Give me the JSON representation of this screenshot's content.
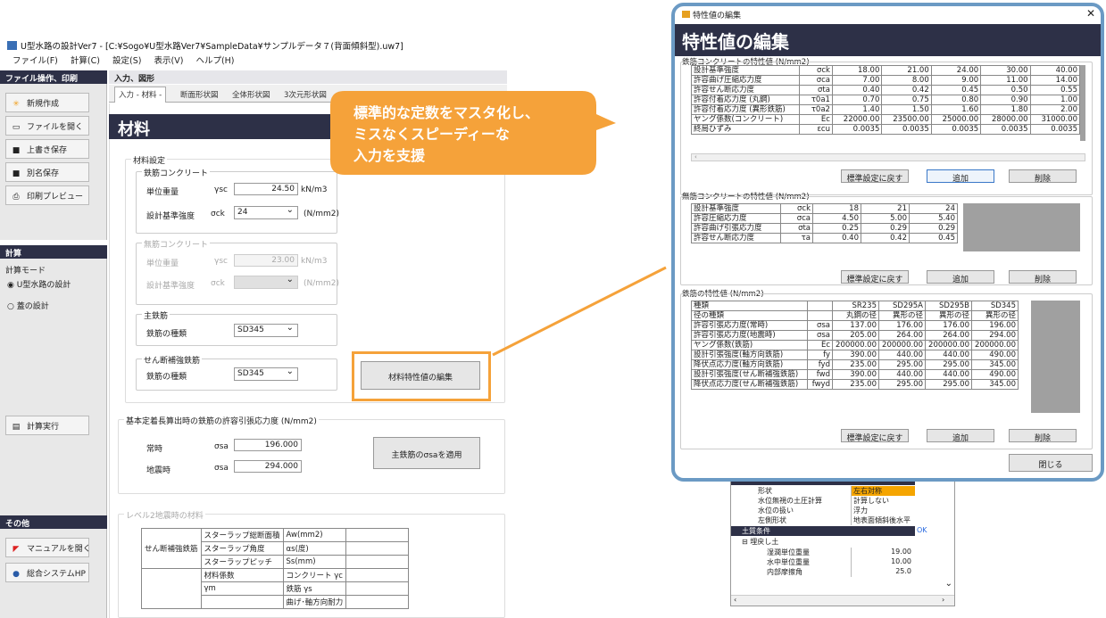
{
  "window": {
    "title": "U型水路の設計Ver7 - [C:¥Sogo¥U型水路Ver7¥SampleData¥サンプルデータ７(背面傾斜型).uw7]"
  },
  "menu": [
    "ファイル(F)",
    "計算(C)",
    "設定(S)",
    "表示(V)",
    "ヘルプ(H)"
  ],
  "left_panel": {
    "file_header": "ファイル操作、印刷",
    "buttons": [
      "新規作成",
      "ファイルを開く",
      "上書き保存",
      "別名保存",
      "印刷プレビュー"
    ],
    "calc_header": "計算",
    "calc_mode_label": "計算モード",
    "modes": [
      "U型水路の設計",
      "蓋の設計"
    ],
    "run_button": "計算実行",
    "other_header": "その他",
    "other_buttons": [
      "マニュアルを開く",
      "総合システムHP"
    ]
  },
  "main": {
    "header": "入力、図形",
    "tabs": [
      "入力 - 材料 -",
      "断面形状図",
      "全体形状図",
      "3次元形状図"
    ],
    "section_title": "材料",
    "material_settings": "材料設定",
    "rc": {
      "title": "鉄筋コンクリート",
      "unit_weight_label": "単位重量",
      "unit_weight_sym": "γsc",
      "unit_weight": "24.50",
      "unit_weight_unit": "kN/m3",
      "strength_label": "設計基準強度",
      "strength_sym": "σck",
      "strength": "24",
      "strength_unit": "(N/mm2)"
    },
    "plain": {
      "title": "無筋コンクリート",
      "unit_weight_label": "単位重量",
      "unit_weight_sym": "γsc",
      "unit_weight": "23.00",
      "unit_weight_unit": "kN/m3",
      "strength_label": "設計基準強度",
      "strength_sym": "σck",
      "strength_unit": "(N/mm2)"
    },
    "main_rebar": {
      "title": "主鉄筋",
      "label": "鉄筋の種類",
      "value": "SD345"
    },
    "shear_rebar": {
      "title": "せん断補強鉄筋",
      "label": "鉄筋の種類",
      "value": "SD345"
    },
    "edit_button": "材料特性値の編集",
    "anchor": {
      "title": "基本定着長算出時の鉄筋の許容引張応力度 (N/mm2)",
      "normal_label": "常時",
      "quake_label": "地震時",
      "sym": "σsa",
      "normal": "196.000",
      "quake": "294.000",
      "apply_button": "主鉄筋のσsaを適用"
    },
    "level2": {
      "title": "レベル2地震時の材料",
      "group": "せん断補強鉄筋",
      "rows": [
        [
          "スターラップ総断面積",
          "Aw(mm2)"
        ],
        [
          "スターラップ角度",
          "αs(度)"
        ],
        [
          "スターラップピッチ",
          "Ss(mm)"
        ],
        [
          "材料係数",
          "コンクリート γc"
        ],
        [
          "γm",
          "鉄筋 γs"
        ],
        [
          "",
          "曲げ･軸方向耐力"
        ]
      ]
    }
  },
  "callout": {
    "lines": [
      "標準的な定数をマスタ化し、",
      "ミスなくスピーディーな",
      "入力を支援"
    ],
    "color": "#f5a23a"
  },
  "dialog": {
    "title": "特性値の編集",
    "heading": "特性値の編集",
    "rc": {
      "title": "鉄筋コンクリートの特性値 (N/mm2)",
      "rows": [
        [
          "設計基準強度",
          "σck",
          "18.00",
          "21.00",
          "24.00",
          "30.00",
          "40.00"
        ],
        [
          "許容曲げ圧縮応力度",
          "σca",
          "7.00",
          "8.00",
          "9.00",
          "11.00",
          "14.00"
        ],
        [
          "許容せん断応力度",
          "σta",
          "0.40",
          "0.42",
          "0.45",
          "0.50",
          "0.55"
        ],
        [
          "許容付着応力度 (丸鋼)",
          "τ0a1",
          "0.70",
          "0.75",
          "0.80",
          "0.90",
          "1.00"
        ],
        [
          "許容付着応力度 (異形鉄筋)",
          "τ0a2",
          "1.40",
          "1.50",
          "1.60",
          "1.80",
          "2.00"
        ],
        [
          "ヤング係数(コンクリート)",
          "Ec",
          "22000.00",
          "23500.00",
          "25000.00",
          "28000.00",
          "31000.00"
        ],
        [
          "終局ひずみ",
          "εcu",
          "0.0035",
          "0.0035",
          "0.0035",
          "0.0035",
          "0.0035"
        ]
      ]
    },
    "plain": {
      "title": "無筋コンクリートの特性値 (N/mm2)",
      "rows": [
        [
          "設計基準強度",
          "σck",
          "18",
          "21",
          "24"
        ],
        [
          "許容圧縮応力度",
          "σca",
          "4.50",
          "5.00",
          "5.40"
        ],
        [
          "許容曲げ引張応力度",
          "σta",
          "0.25",
          "0.29",
          "0.29"
        ],
        [
          "許容せん断応力度",
          "τa",
          "0.40",
          "0.42",
          "0.45"
        ]
      ]
    },
    "rebar": {
      "title": "鉄筋の特性値 (N/mm2)",
      "rows": [
        [
          "種類",
          "",
          "SR235",
          "SD295A",
          "SD295B",
          "SD345"
        ],
        [
          "径の種類",
          "",
          "丸鋼の径",
          "異形の径",
          "異形の径",
          "異形の径"
        ],
        [
          "許容引張応力度(常時)",
          "σsa",
          "137.00",
          "176.00",
          "176.00",
          "196.00"
        ],
        [
          "許容引張応力度(地震時)",
          "σsa",
          "205.00",
          "264.00",
          "264.00",
          "294.00"
        ],
        [
          "ヤング係数(鉄筋)",
          "Ec",
          "200000.00",
          "200000.00",
          "200000.00",
          "200000.00"
        ],
        [
          "設計引張強度(軸方向鉄筋)",
          "fy",
          "390.00",
          "440.00",
          "440.00",
          "490.00"
        ],
        [
          "降伏点応力度(軸方向鉄筋)",
          "fyd",
          "235.00",
          "295.00",
          "295.00",
          "345.00"
        ],
        [
          "設計引張強度(せん断補強鉄筋)",
          "fwd",
          "390.00",
          "440.00",
          "440.00",
          "490.00"
        ],
        [
          "降伏点応力度(せん断補強鉄筋)",
          "fwyd",
          "235.00",
          "295.00",
          "295.00",
          "345.00"
        ]
      ]
    },
    "btn_reset": "標準設定に戻す",
    "btn_add": "追加",
    "btn_delete": "削除",
    "btn_close": "閉じる"
  },
  "props": {
    "rows": [
      [
        "形状",
        "左右対称"
      ],
      [
        "水位無視の土圧計算",
        "計算しない"
      ],
      [
        "水位の扱い",
        "浮力"
      ],
      [
        "左側形状",
        "地表面傾斜後水平"
      ],
      [
        "土質条件",
        "OK"
      ],
      [
        "埋戻し土",
        ""
      ],
      [
        "湿潤単位重量",
        "19.00"
      ],
      [
        "水中単位重量",
        "10.00"
      ],
      [
        "内部摩擦角",
        "25.0"
      ]
    ],
    "top_ok": "OK"
  }
}
